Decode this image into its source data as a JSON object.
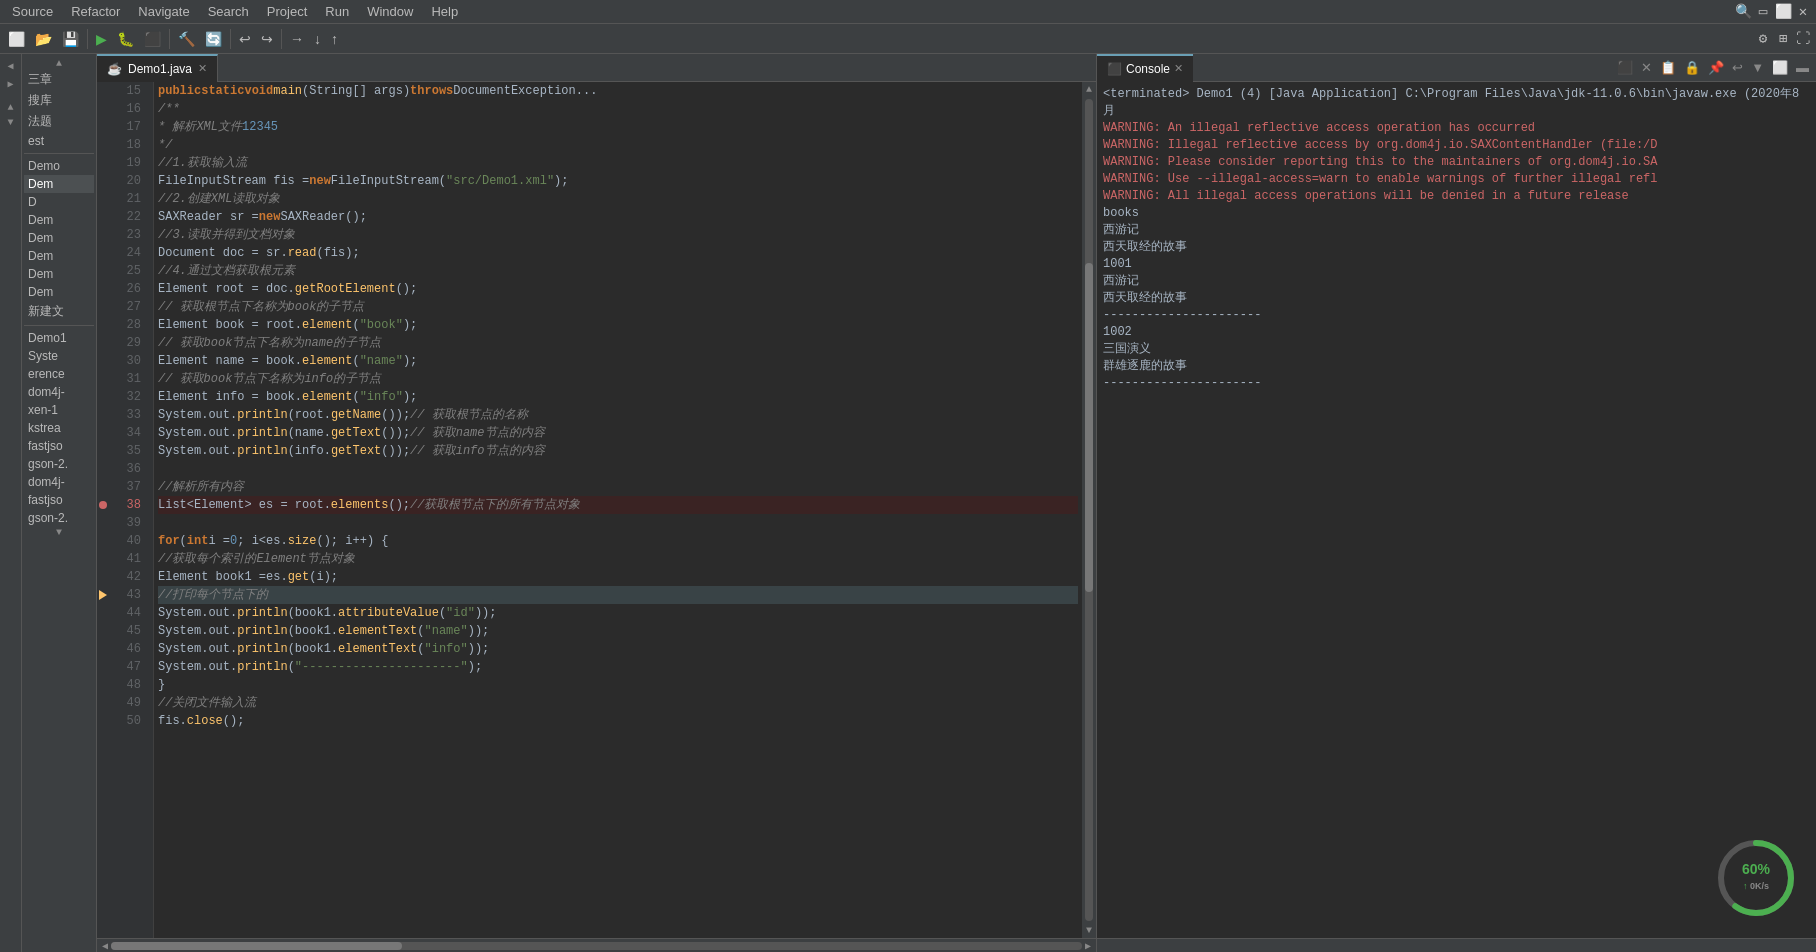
{
  "menubar": {
    "items": [
      "Source",
      "Refactor",
      "Navigate",
      "Search",
      "Project",
      "Run",
      "Window",
      "Help"
    ]
  },
  "toolbar": {
    "icons": [
      "⬜",
      "⬜",
      "⬜",
      "▶",
      "⬜",
      "⬜",
      "⬜",
      "⬜",
      "⬜",
      "⬜",
      "⬜",
      "⬜",
      "⬜",
      "⬜",
      "⬜",
      "⬜",
      "⬜",
      "⬜",
      "⬜",
      "⬜",
      "⬜",
      "⬜",
      "⬜"
    ]
  },
  "editor": {
    "tab_name": "Demo1.java",
    "lines": [
      {
        "num": "15",
        "tokens": [
          {
            "t": "   public ",
            "c": "kw"
          },
          {
            "t": "static ",
            "c": "kw"
          },
          {
            "t": "void ",
            "c": "kw"
          },
          {
            "t": "main",
            "c": "method"
          },
          {
            "t": "(String[] args) ",
            "c": "plain"
          },
          {
            "t": "throws ",
            "c": "kw"
          },
          {
            "t": "DocumentException...",
            "c": "class-name"
          }
        ]
      },
      {
        "num": "16",
        "tokens": [
          {
            "t": "      /**",
            "c": "comment"
          }
        ]
      },
      {
        "num": "17",
        "tokens": [
          {
            "t": "       * 解析XML文件 ",
            "c": "comment"
          },
          {
            "t": "1",
            "c": "num"
          },
          {
            "t": " ",
            "c": "comment"
          },
          {
            "t": "2",
            "c": "num"
          },
          {
            "t": " ",
            "c": "comment"
          },
          {
            "t": "3",
            "c": "num"
          },
          {
            "t": " ",
            "c": "comment"
          },
          {
            "t": "4",
            "c": "num"
          },
          {
            "t": " ",
            "c": "comment"
          },
          {
            "t": "5",
            "c": "num"
          }
        ]
      },
      {
        "num": "18",
        "tokens": [
          {
            "t": "       */",
            "c": "comment"
          }
        ]
      },
      {
        "num": "19",
        "tokens": [
          {
            "t": "      ",
            "c": "plain"
          },
          {
            "t": "//1.获取输入流",
            "c": "comment"
          }
        ]
      },
      {
        "num": "20",
        "tokens": [
          {
            "t": "      FileInputStream fis = ",
            "c": "plain"
          },
          {
            "t": "new ",
            "c": "kw"
          },
          {
            "t": "FileInputStream(",
            "c": "plain"
          },
          {
            "t": "\"src/Demo1.xml\"",
            "c": "string"
          },
          {
            "t": ")",
            "c": "plain"
          }
        ]
      },
      {
        "num": "21",
        "tokens": [
          {
            "t": "      ",
            "c": "plain"
          },
          {
            "t": "//2.创建XML读取对象",
            "c": "comment"
          }
        ]
      },
      {
        "num": "22",
        "tokens": [
          {
            "t": "      SAXReader sr = ",
            "c": "plain"
          },
          {
            "t": "new ",
            "c": "kw"
          },
          {
            "t": "SAXReader();",
            "c": "plain"
          }
        ]
      },
      {
        "num": "23",
        "tokens": [
          {
            "t": "      ",
            "c": "plain"
          },
          {
            "t": "//3.读取并得到文档对象",
            "c": "comment"
          }
        ]
      },
      {
        "num": "24",
        "tokens": [
          {
            "t": "      Document doc = sr.",
            "c": "plain"
          },
          {
            "t": "read",
            "c": "method"
          },
          {
            "t": "(fis);",
            "c": "plain"
          }
        ]
      },
      {
        "num": "25",
        "tokens": [
          {
            "t": "      ",
            "c": "plain"
          },
          {
            "t": "//4.通过文档获取根元素",
            "c": "comment"
          }
        ]
      },
      {
        "num": "26",
        "tokens": [
          {
            "t": "      Element root = doc.",
            "c": "plain"
          },
          {
            "t": "getRootElement",
            "c": "method"
          },
          {
            "t": "();",
            "c": "plain"
          }
        ]
      },
      {
        "num": "27",
        "tokens": [
          {
            "t": "      ",
            "c": "plain"
          },
          {
            "t": "// 获取根节点下名称为book的子节点",
            "c": "comment"
          }
        ]
      },
      {
        "num": "28",
        "tokens": [
          {
            "t": "      Element book = root.",
            "c": "plain"
          },
          {
            "t": "element",
            "c": "method"
          },
          {
            "t": "(",
            "c": "plain"
          },
          {
            "t": "\"book\"",
            "c": "string"
          },
          {
            "t": ");",
            "c": "plain"
          }
        ]
      },
      {
        "num": "29",
        "tokens": [
          {
            "t": "      ",
            "c": "plain"
          },
          {
            "t": "// 获取book节点下名称为name的子节点",
            "c": "comment"
          }
        ]
      },
      {
        "num": "30",
        "tokens": [
          {
            "t": "      Element name = book.",
            "c": "plain"
          },
          {
            "t": "element",
            "c": "method"
          },
          {
            "t": "(",
            "c": "plain"
          },
          {
            "t": "\"name\"",
            "c": "string"
          },
          {
            "t": ");",
            "c": "plain"
          }
        ]
      },
      {
        "num": "31",
        "tokens": [
          {
            "t": "      ",
            "c": "plain"
          },
          {
            "t": "// 获取book节点下名称为info的子节点",
            "c": "comment"
          }
        ]
      },
      {
        "num": "32",
        "tokens": [
          {
            "t": "      Element info = book.",
            "c": "plain"
          },
          {
            "t": "element",
            "c": "method"
          },
          {
            "t": "(",
            "c": "plain"
          },
          {
            "t": "\"info\"",
            "c": "string"
          },
          {
            "t": ");",
            "c": "plain"
          }
        ]
      },
      {
        "num": "33",
        "tokens": [
          {
            "t": "      System.",
            "c": "plain"
          },
          {
            "t": "out",
            "c": "plain"
          },
          {
            "t": ".",
            "c": "plain"
          },
          {
            "t": "println",
            "c": "method"
          },
          {
            "t": "(root.",
            "c": "plain"
          },
          {
            "t": "getName",
            "c": "method"
          },
          {
            "t": "());",
            "c": "plain"
          },
          {
            "t": "// 获取根节点的名称",
            "c": "comment"
          }
        ]
      },
      {
        "num": "34",
        "tokens": [
          {
            "t": "      System.",
            "c": "plain"
          },
          {
            "t": "out",
            "c": "plain"
          },
          {
            "t": ".",
            "c": "plain"
          },
          {
            "t": "println",
            "c": "method"
          },
          {
            "t": "(name.",
            "c": "plain"
          },
          {
            "t": "getText",
            "c": "method"
          },
          {
            "t": "());",
            "c": "plain"
          },
          {
            "t": "// 获取name节点的内容",
            "c": "comment"
          }
        ]
      },
      {
        "num": "35",
        "tokens": [
          {
            "t": "      System.",
            "c": "plain"
          },
          {
            "t": "out",
            "c": "plain"
          },
          {
            "t": ".",
            "c": "plain"
          },
          {
            "t": "println",
            "c": "method"
          },
          {
            "t": "(info.",
            "c": "plain"
          },
          {
            "t": "getText",
            "c": "method"
          },
          {
            "t": "());",
            "c": "plain"
          },
          {
            "t": "// 获取info节点的内容",
            "c": "comment"
          }
        ]
      },
      {
        "num": "36",
        "tokens": []
      },
      {
        "num": "37",
        "tokens": [
          {
            "t": "      ",
            "c": "plain"
          },
          {
            "t": "//解析所有内容",
            "c": "comment"
          }
        ]
      },
      {
        "num": "38",
        "tokens": [
          {
            "t": "      List<Element> es = root.",
            "c": "plain"
          },
          {
            "t": "elements",
            "c": "method"
          },
          {
            "t": "();   ",
            "c": "plain"
          },
          {
            "t": "//获取根节点下的所有节点对象",
            "c": "comment"
          }
        ],
        "error": true
      },
      {
        "num": "39",
        "tokens": []
      },
      {
        "num": "40",
        "tokens": [
          {
            "t": "      ",
            "c": "plain"
          },
          {
            "t": "for",
            "c": "kw"
          },
          {
            "t": "(",
            "c": "plain"
          },
          {
            "t": "int ",
            "c": "kw"
          },
          {
            "t": "i = ",
            "c": "plain"
          },
          {
            "t": "0",
            "c": "num"
          },
          {
            "t": "; i<es.",
            "c": "plain"
          },
          {
            "t": "size",
            "c": "method"
          },
          {
            "t": "(); i++) {",
            "c": "plain"
          }
        ]
      },
      {
        "num": "41",
        "tokens": [
          {
            "t": "         ",
            "c": "plain"
          },
          {
            "t": "//获取每个索引的Element节点对象",
            "c": "comment"
          }
        ]
      },
      {
        "num": "42",
        "tokens": [
          {
            "t": "         Element book1 =es.",
            "c": "plain"
          },
          {
            "t": "get",
            "c": "method"
          },
          {
            "t": "(i);",
            "c": "plain"
          }
        ]
      },
      {
        "num": "43",
        "tokens": [
          {
            "t": "         ",
            "c": "plain"
          },
          {
            "t": "//打印每个节点下的",
            "c": "comment"
          }
        ],
        "highlighted": true
      },
      {
        "num": "44",
        "tokens": [
          {
            "t": "         System.",
            "c": "plain"
          },
          {
            "t": "out",
            "c": "plain"
          },
          {
            "t": ".",
            "c": "plain"
          },
          {
            "t": "println",
            "c": "method"
          },
          {
            "t": "(book1.",
            "c": "plain"
          },
          {
            "t": "attributeValue",
            "c": "method"
          },
          {
            "t": "(",
            "c": "plain"
          },
          {
            "t": "\"id\"",
            "c": "string"
          },
          {
            "t": "));",
            "c": "plain"
          }
        ]
      },
      {
        "num": "45",
        "tokens": [
          {
            "t": "         System.",
            "c": "plain"
          },
          {
            "t": "out",
            "c": "plain"
          },
          {
            "t": ".",
            "c": "plain"
          },
          {
            "t": "println",
            "c": "method"
          },
          {
            "t": "(book1.",
            "c": "plain"
          },
          {
            "t": "elementText",
            "c": "method"
          },
          {
            "t": "(",
            "c": "plain"
          },
          {
            "t": "\"name\"",
            "c": "string"
          },
          {
            "t": "));",
            "c": "plain"
          }
        ]
      },
      {
        "num": "46",
        "tokens": [
          {
            "t": "         System.",
            "c": "plain"
          },
          {
            "t": "out",
            "c": "plain"
          },
          {
            "t": ".",
            "c": "plain"
          },
          {
            "t": "println",
            "c": "method"
          },
          {
            "t": "(book1.",
            "c": "plain"
          },
          {
            "t": "elementText",
            "c": "method"
          },
          {
            "t": "(",
            "c": "plain"
          },
          {
            "t": "\"info\"",
            "c": "string"
          },
          {
            "t": "));",
            "c": "plain"
          }
        ]
      },
      {
        "num": "47",
        "tokens": [
          {
            "t": "         System.",
            "c": "plain"
          },
          {
            "t": "out",
            "c": "plain"
          },
          {
            "t": ".",
            "c": "plain"
          },
          {
            "t": "println",
            "c": "method"
          },
          {
            "t": "(",
            "c": "plain"
          },
          {
            "t": "\"----------------------\"",
            "c": "string"
          },
          {
            "t": ");",
            "c": "plain"
          }
        ]
      },
      {
        "num": "48",
        "tokens": [
          {
            "t": "      }",
            "c": "plain"
          }
        ]
      },
      {
        "num": "49",
        "tokens": [
          {
            "t": "      ",
            "c": "plain"
          },
          {
            "t": "//关闭文件输入流",
            "c": "comment"
          }
        ]
      },
      {
        "num": "50",
        "tokens": [
          {
            "t": "      fis.",
            "c": "plain"
          },
          {
            "t": "close",
            "c": "method"
          },
          {
            "t": "();",
            "c": "plain"
          }
        ]
      }
    ]
  },
  "console": {
    "tab_name": "Console",
    "header": "<terminated> Demo1 (4) [Java Application] C:\\Program Files\\Java\\jdk-11.0.6\\bin\\javaw.exe (2020年8月",
    "lines": [
      {
        "text": "WARNING: An illegal reflective access operation has occurred",
        "type": "warning"
      },
      {
        "text": "WARNING: Illegal reflective access by org.dom4j.io.SAXContentHandler (file:/D",
        "type": "warning"
      },
      {
        "text": "WARNING: Please consider reporting this to the maintainers of org.dom4j.io.SA",
        "type": "warning"
      },
      {
        "text": "WARNING: Use --illegal-access=warn to enable warnings of further illegal refl",
        "type": "warning"
      },
      {
        "text": "WARNING: All illegal access operations will be denied in a future release",
        "type": "warning"
      },
      {
        "text": "books",
        "type": "normal"
      },
      {
        "text": "西游记",
        "type": "normal"
      },
      {
        "text": "西天取经的故事",
        "type": "normal"
      },
      {
        "text": "1001",
        "type": "normal"
      },
      {
        "text": "西游记",
        "type": "normal"
      },
      {
        "text": "西天取经的故事",
        "type": "normal"
      },
      {
        "text": "----------------------",
        "type": "normal"
      },
      {
        "text": "1002",
        "type": "normal"
      },
      {
        "text": "三国演义",
        "type": "normal"
      },
      {
        "text": "群雄逐鹿的故事",
        "type": "normal"
      },
      {
        "text": "----------------------",
        "type": "normal"
      }
    ],
    "progress": {
      "percent": 60,
      "label": "60%",
      "sublabel": "0K/s"
    }
  },
  "sidebar": {
    "items": [
      {
        "label": "三章",
        "active": false
      },
      {
        "label": "搜库",
        "active": false
      },
      {
        "label": "法题",
        "active": false
      },
      {
        "label": "est",
        "active": false
      },
      {
        "label": "Demo",
        "active": false
      },
      {
        "label": "Dem",
        "active": true
      },
      {
        "label": "D",
        "active": false
      },
      {
        "label": "Dem",
        "active": false
      },
      {
        "label": "Dem",
        "active": false
      },
      {
        "label": "Dem",
        "active": false
      },
      {
        "label": "Dem",
        "active": false
      },
      {
        "label": "Dem",
        "active": false
      },
      {
        "label": "新建文",
        "active": false
      },
      {
        "label": "Demo1",
        "active": false
      },
      {
        "label": "Syste",
        "active": false
      },
      {
        "label": "erence",
        "active": false
      },
      {
        "label": "dom4j-",
        "active": false
      },
      {
        "label": "xen-1",
        "active": false
      },
      {
        "label": "kstrea",
        "active": false
      },
      {
        "label": "fastjso",
        "active": false
      },
      {
        "label": "gson-2.",
        "active": false
      },
      {
        "label": "dom4j-",
        "active": false
      },
      {
        "label": "fastjso",
        "active": false
      },
      {
        "label": "gson-2.",
        "active": false
      }
    ]
  }
}
